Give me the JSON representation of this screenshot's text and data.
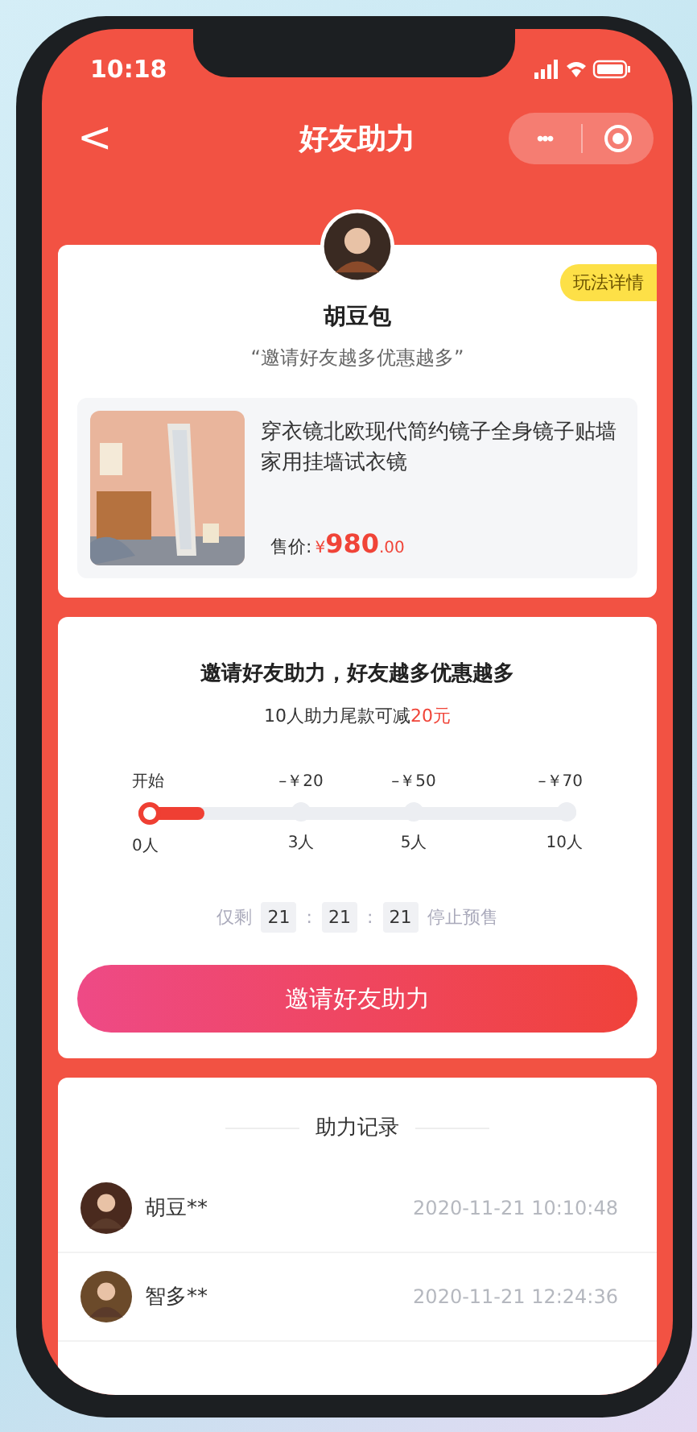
{
  "status_bar": {
    "time": "10:18"
  },
  "nav": {
    "back": "<",
    "title": "好友助力",
    "more": "•••"
  },
  "profile": {
    "name": "胡豆包",
    "slogan": "“邀请好友越多优惠越多”",
    "rules_badge": "玩法详情"
  },
  "product": {
    "title": "穿衣镜北欧现代简约镜子全身镜子贴墙家用挂墙试衣镜",
    "price_label": "售价:",
    "currency": "¥",
    "price_int": "980",
    "price_dec": ".00"
  },
  "assist": {
    "title": "邀请好友助力，好友越多优惠越多",
    "subtitle": "10人助力尾款可减",
    "subtitle_highlight": "20元",
    "progress": {
      "level": 0.15
    },
    "milestones": [
      {
        "top": "开始",
        "bottom": "0人",
        "reached": true
      },
      {
        "top": "–￥20",
        "bottom": "3人",
        "reached": false
      },
      {
        "top": "–￥50",
        "bottom": "5人",
        "reached": false
      },
      {
        "top": "–￥70",
        "bottom": "10人",
        "reached": false
      }
    ],
    "countdown": {
      "prefix": "仅剩",
      "hours": "21",
      "sep1": ":",
      "minutes": "21",
      "sep2": ":",
      "seconds": "21",
      "suffix": "停止预售"
    },
    "invite_button": "邀请好友助力"
  },
  "records": {
    "title": "助力记录",
    "items": [
      {
        "name": "胡豆**",
        "time": "2020-11-21 10:10:48"
      },
      {
        "name": "智多**",
        "time": "2020-11-21 12:24:36"
      }
    ]
  }
}
